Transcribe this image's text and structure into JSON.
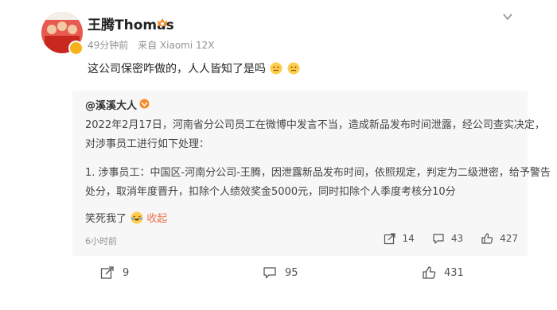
{
  "post": {
    "username": "王腾Thomas",
    "time": "49分钟前",
    "source": "来自 Xiaomi 12X",
    "text": "这公司保密咋做的，人人皆知了是吗",
    "emoji": "thinking-face-emoji"
  },
  "repost": {
    "author": "@溪溪大人",
    "lines": [
      "2022年2月17日，河南省分公司员工在微博中发言不当，造成新品发布时间泄露，经公司查实决定，",
      "对涉事员工进行如下处理：",
      "1. 涉事员工：中国区-河南分公司-王腾，因泄露新品发布时间，依照规定，判定为二级泄密，给予警告",
      "处分，取消年度晋升，扣除个人绩效奖金5000元，同时扣除个人季度考核分10分"
    ],
    "footer_text": "笑死我了",
    "collapse_label": "收起",
    "time": "6小时前",
    "forwards": "14",
    "comments": "43",
    "likes": "427"
  },
  "actions": {
    "forwards": "9",
    "comments": "95",
    "likes": "431"
  },
  "colors": {
    "accent": "#eb7350",
    "repost_bg": "#f7f7f7",
    "meta": "#939393"
  }
}
